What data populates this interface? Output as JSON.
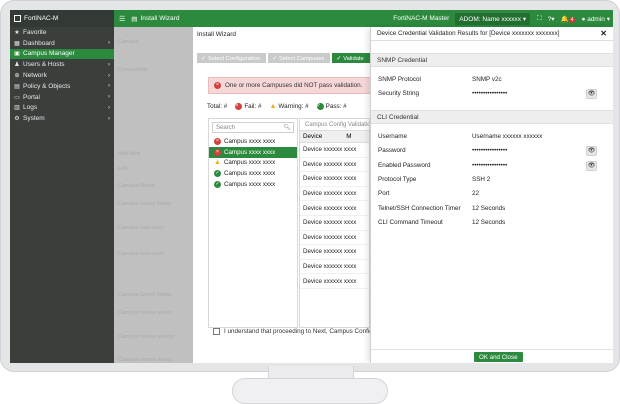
{
  "topbar": {
    "brand": "FortiNAC-M",
    "wizard_title": "Install Wizard",
    "host": "FortiNAC-M Master",
    "adom": "ADOM: Name xxxxxx",
    "alert_count": "4",
    "user": "admin",
    "icons": [
      "menu-icon",
      "fullscreen-icon",
      "help-icon",
      "bell-icon",
      "user-icon"
    ]
  },
  "sidebar": {
    "items": [
      {
        "label": "Favorite",
        "icon": "star-icon",
        "active": false,
        "chevron": false
      },
      {
        "label": "Dashboard",
        "icon": "dashboard-icon",
        "active": false,
        "chevron": true
      },
      {
        "label": "Campus Manager",
        "icon": "campus-icon",
        "active": true,
        "chevron": false
      },
      {
        "label": "Users & Hosts",
        "icon": "users-icon",
        "active": false,
        "chevron": true
      },
      {
        "label": "Network",
        "icon": "network-icon",
        "active": false,
        "chevron": true
      },
      {
        "label": "Policy & Objects",
        "icon": "policy-icon",
        "active": false,
        "chevron": true
      },
      {
        "label": "Portal",
        "icon": "portal-icon",
        "active": false,
        "chevron": true
      },
      {
        "label": "Logs",
        "icon": "logs-icon",
        "active": false,
        "chevron": true
      },
      {
        "label": "System",
        "icon": "gear-icon",
        "active": false,
        "chevron": true
      }
    ]
  },
  "background": {
    "rows": [
      "Campus",
      "Connectivity",
      "Add New",
      "Edit",
      "Campus Name",
      "Campus Group Name",
      "Campus xxxx xxxx",
      "Campus xxxx xxxx",
      "Campus Group Name",
      "Campus xxxxxx xxxxx",
      "Campus xxxxxx xxxxxx",
      "Campus xxxxxx xxxxx"
    ]
  },
  "wizard": {
    "title": "Install Wizard",
    "steps": [
      "Select Configuration",
      "Select Campuses",
      "Validate"
    ],
    "alert": "One or more Campuses did NOT pass validation.",
    "summary": {
      "total": "Total: #",
      "fail": "Fail: #",
      "warning": "Warning: #",
      "pass": "Pass: #"
    },
    "search_placeholder": "Search",
    "campuses": [
      {
        "name": "Campus xxxx xxxx",
        "status": "fail",
        "selected": false
      },
      {
        "name": "Campus xxxx xxxx",
        "status": "fail",
        "selected": true
      },
      {
        "name": "Campus xxxx xxxx",
        "status": "warning",
        "selected": false
      },
      {
        "name": "Campus xxxx xxxx",
        "status": "pass",
        "selected": false
      },
      {
        "name": "Campus xxxx xxxx",
        "status": "pass",
        "selected": false
      }
    ],
    "device_tab": "Campus Config Validation",
    "device_header": [
      "Device",
      "M"
    ],
    "devices": [
      {
        "name": "Device xxxxxx xxxx",
        "status": "fail"
      },
      {
        "name": "Device xxxxxx xxxx",
        "status": "fail"
      },
      {
        "name": "Device xxxxxx xxxx",
        "status": "fail"
      },
      {
        "name": "Device xxxxxx xxxx",
        "status": "fail"
      },
      {
        "name": "Device xxxxxx xxxx",
        "status": "warning"
      },
      {
        "name": "Device xxxxxx xxxx",
        "status": "fail"
      },
      {
        "name": "Device xxxxxx xxxx",
        "status": "fail"
      },
      {
        "name": "Device xxxxxx xxxx",
        "status": "fail"
      },
      {
        "name": "Device xxxxxx xxxx",
        "status": "fail"
      },
      {
        "name": "Device xxxxxx xxxx",
        "status": "fail"
      }
    ],
    "confirm_text": "I understand that proceeding to Next, Campus Config"
  },
  "dialog": {
    "title": "Device Credential Validation Results for [Device xxxxxxx xxxxxxx]",
    "snmp_section": "SNMP Credential",
    "snmp_fields": [
      {
        "label": "SNMP Protocol",
        "value": "SNMP v2c",
        "eye": false
      },
      {
        "label": "Security String",
        "value": "••••••••••••••••",
        "eye": true
      }
    ],
    "cli_section": "CLI Credential",
    "cli_fields": [
      {
        "label": "Username",
        "value": "Username xxxxxx xxxxxx",
        "eye": false
      },
      {
        "label": "Password",
        "value": "••••••••••••••••",
        "eye": true
      },
      {
        "label": "Enabled Password",
        "value": "••••••••••••••••",
        "eye": true
      },
      {
        "label": "Protocol Type",
        "value": "SSH 2",
        "eye": false
      },
      {
        "label": "Port",
        "value": "22",
        "eye": false
      },
      {
        "label": "Telnet/SSH Connection Timer",
        "value": "12 Seconds",
        "eye": false
      },
      {
        "label": "CLI Command Timeout",
        "value": "12 Seconds",
        "eye": false
      }
    ],
    "ok_button": "OK and Close"
  },
  "colors": {
    "accent": "#2c8a3e",
    "sidebar": "#3a3f3c",
    "error": "#d43f3a",
    "warning": "#f0ad1a"
  }
}
